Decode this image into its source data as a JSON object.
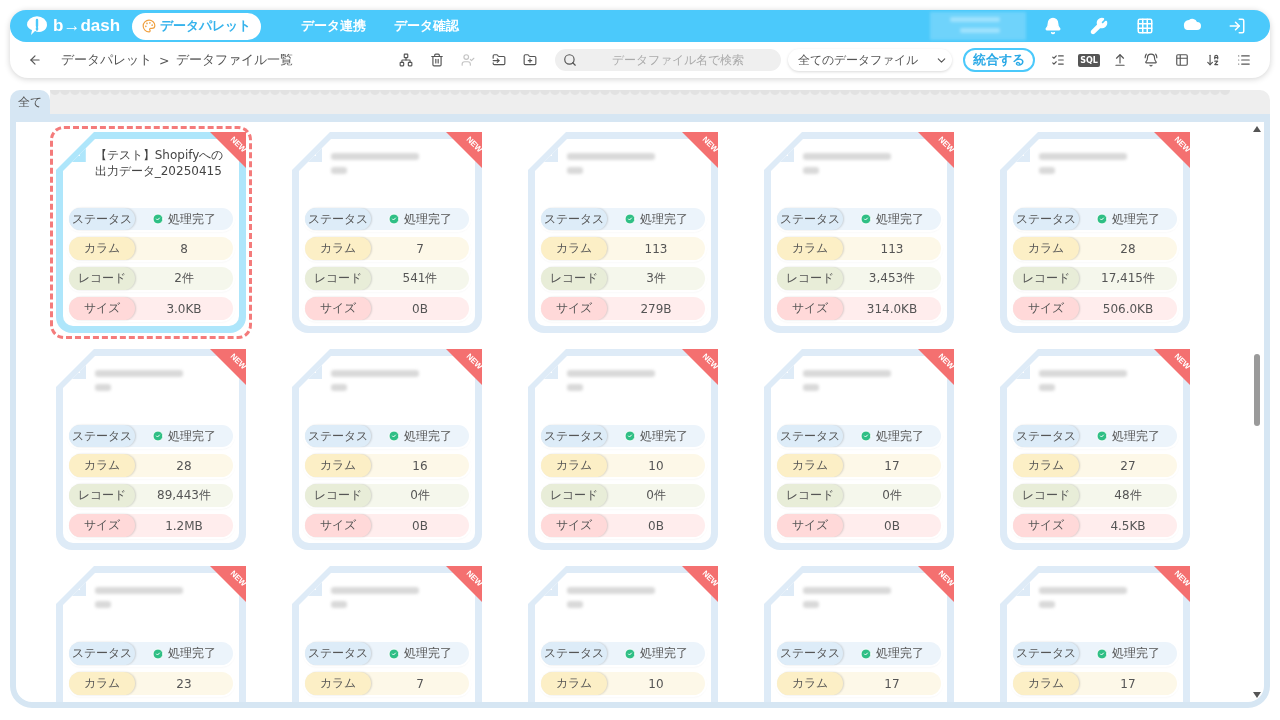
{
  "header": {
    "logo": "b→dash",
    "nav": [
      {
        "label": "データパレット",
        "selected": true
      },
      {
        "label": "データ連携",
        "selected": false
      },
      {
        "label": "データ確認",
        "selected": false
      }
    ],
    "icons": [
      {
        "kind": "bell"
      },
      {
        "kind": "wrench"
      },
      {
        "kind": "apps"
      },
      {
        "kind": "mascot"
      },
      {
        "kind": "logout"
      }
    ]
  },
  "toolbar": {
    "breadcrumb": [
      "データパレット",
      ">",
      "データファイル一覧"
    ],
    "actions": [
      {
        "kind": "hierarchy",
        "disabled": false
      },
      {
        "kind": "delete",
        "disabled": false
      },
      {
        "kind": "assign",
        "disabled": true
      },
      {
        "kind": "move",
        "disabled": false
      },
      {
        "kind": "new-folder",
        "disabled": false
      }
    ],
    "search": {
      "placeholder": "データファイル名で検索"
    },
    "filter": {
      "value": "全てのデータファイル"
    },
    "merge_button": "統合する",
    "tools": [
      {
        "kind": "checklist"
      },
      {
        "kind": "sql",
        "label": "SQL"
      },
      {
        "kind": "upload"
      },
      {
        "kind": "notify-list"
      },
      {
        "kind": "table"
      },
      {
        "kind": "sort"
      },
      {
        "kind": "list"
      }
    ]
  },
  "tabs": [
    {
      "label": "全て",
      "selected": true
    }
  ],
  "cards": [
    {
      "title": "【テスト】Shopifyへの出力データ_20250415",
      "selected": true,
      "badge": "NEW",
      "stats": [
        {
          "kind": "status",
          "label": "ステータス",
          "value": "処理完了"
        },
        {
          "kind": "columns",
          "label": "カラム",
          "value": "8"
        },
        {
          "kind": "records",
          "label": "レコード",
          "value": "2件"
        },
        {
          "kind": "size",
          "label": "サイズ",
          "value": "3.0KB"
        }
      ]
    },
    {
      "selected": false,
      "badge": "NEW",
      "stats": [
        {
          "kind": "status",
          "label": "ステータス",
          "value": "処理完了"
        },
        {
          "kind": "columns",
          "label": "カラム",
          "value": "7"
        },
        {
          "kind": "records",
          "label": "レコード",
          "value": "541件"
        },
        {
          "kind": "size",
          "label": "サイズ",
          "value": "0B"
        }
      ]
    },
    {
      "selected": false,
      "badge": "NEW",
      "stats": [
        {
          "kind": "status",
          "label": "ステータス",
          "value": "処理完了"
        },
        {
          "kind": "columns",
          "label": "カラム",
          "value": "113"
        },
        {
          "kind": "records",
          "label": "レコード",
          "value": "3件"
        },
        {
          "kind": "size",
          "label": "サイズ",
          "value": "279B"
        }
      ]
    },
    {
      "selected": false,
      "badge": "NEW",
      "stats": [
        {
          "kind": "status",
          "label": "ステータス",
          "value": "処理完了"
        },
        {
          "kind": "columns",
          "label": "カラム",
          "value": "113"
        },
        {
          "kind": "records",
          "label": "レコード",
          "value": "3,453件"
        },
        {
          "kind": "size",
          "label": "サイズ",
          "value": "314.0KB"
        }
      ]
    },
    {
      "selected": false,
      "badge": "NEW",
      "stats": [
        {
          "kind": "status",
          "label": "ステータス",
          "value": "処理完了"
        },
        {
          "kind": "columns",
          "label": "カラム",
          "value": "28"
        },
        {
          "kind": "records",
          "label": "レコード",
          "value": "17,415件"
        },
        {
          "kind": "size",
          "label": "サイズ",
          "value": "506.0KB"
        }
      ]
    },
    {
      "selected": false,
      "badge": "NEW",
      "stats": [
        {
          "kind": "status",
          "label": "ステータス",
          "value": "処理完了"
        },
        {
          "kind": "columns",
          "label": "カラム",
          "value": "28"
        },
        {
          "kind": "records",
          "label": "レコード",
          "value": "89,443件"
        },
        {
          "kind": "size",
          "label": "サイズ",
          "value": "1.2MB"
        }
      ]
    },
    {
      "selected": false,
      "badge": "NEW",
      "stats": [
        {
          "kind": "status",
          "label": "ステータス",
          "value": "処理完了"
        },
        {
          "kind": "columns",
          "label": "カラム",
          "value": "16"
        },
        {
          "kind": "records",
          "label": "レコード",
          "value": "0件"
        },
        {
          "kind": "size",
          "label": "サイズ",
          "value": "0B"
        }
      ]
    },
    {
      "selected": false,
      "badge": "NEW",
      "stats": [
        {
          "kind": "status",
          "label": "ステータス",
          "value": "処理完了"
        },
        {
          "kind": "columns",
          "label": "カラム",
          "value": "10"
        },
        {
          "kind": "records",
          "label": "レコード",
          "value": "0件"
        },
        {
          "kind": "size",
          "label": "サイズ",
          "value": "0B"
        }
      ]
    },
    {
      "selected": false,
      "badge": "NEW",
      "stats": [
        {
          "kind": "status",
          "label": "ステータス",
          "value": "処理完了"
        },
        {
          "kind": "columns",
          "label": "カラム",
          "value": "17"
        },
        {
          "kind": "records",
          "label": "レコード",
          "value": "0件"
        },
        {
          "kind": "size",
          "label": "サイズ",
          "value": "0B"
        }
      ]
    },
    {
      "selected": false,
      "badge": "NEW",
      "stats": [
        {
          "kind": "status",
          "label": "ステータス",
          "value": "処理完了"
        },
        {
          "kind": "columns",
          "label": "カラム",
          "value": "27"
        },
        {
          "kind": "records",
          "label": "レコード",
          "value": "48件"
        },
        {
          "kind": "size",
          "label": "サイズ",
          "value": "4.5KB"
        }
      ]
    },
    {
      "selected": false,
      "badge": "NEW",
      "stats": [
        {
          "kind": "status",
          "label": "ステータス",
          "value": "処理完了"
        },
        {
          "kind": "columns",
          "label": "カラム",
          "value": "23"
        }
      ]
    },
    {
      "selected": false,
      "badge": "NEW",
      "stats": [
        {
          "kind": "status",
          "label": "ステータス",
          "value": "処理完了"
        },
        {
          "kind": "columns",
          "label": "カラム",
          "value": "7"
        }
      ]
    },
    {
      "selected": false,
      "badge": "NEW",
      "stats": [
        {
          "kind": "status",
          "label": "ステータス",
          "value": "処理完了"
        },
        {
          "kind": "columns",
          "label": "カラム",
          "value": "10"
        }
      ]
    },
    {
      "selected": false,
      "badge": "NEW",
      "stats": [
        {
          "kind": "status",
          "label": "ステータス",
          "value": "処理完了"
        },
        {
          "kind": "columns",
          "label": "カラム",
          "value": "17"
        }
      ]
    },
    {
      "selected": false,
      "badge": "NEW",
      "stats": [
        {
          "kind": "status",
          "label": "ステータス",
          "value": "処理完了"
        },
        {
          "kind": "columns",
          "label": "カラム",
          "value": "17"
        }
      ]
    }
  ]
}
